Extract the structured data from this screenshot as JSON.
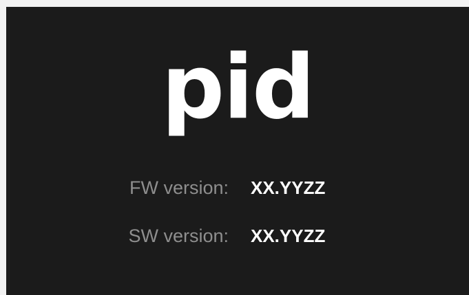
{
  "logo": {
    "text": "pid"
  },
  "versions": {
    "fw": {
      "label": "FW version:",
      "value": "XX.YYZZ"
    },
    "sw": {
      "label": "SW version:",
      "value": "XX.YYZZ"
    }
  },
  "colors": {
    "background": "#1b1b1b",
    "page": "#f2f2f2",
    "label": "#8e8e8e",
    "value": "#ffffff"
  }
}
